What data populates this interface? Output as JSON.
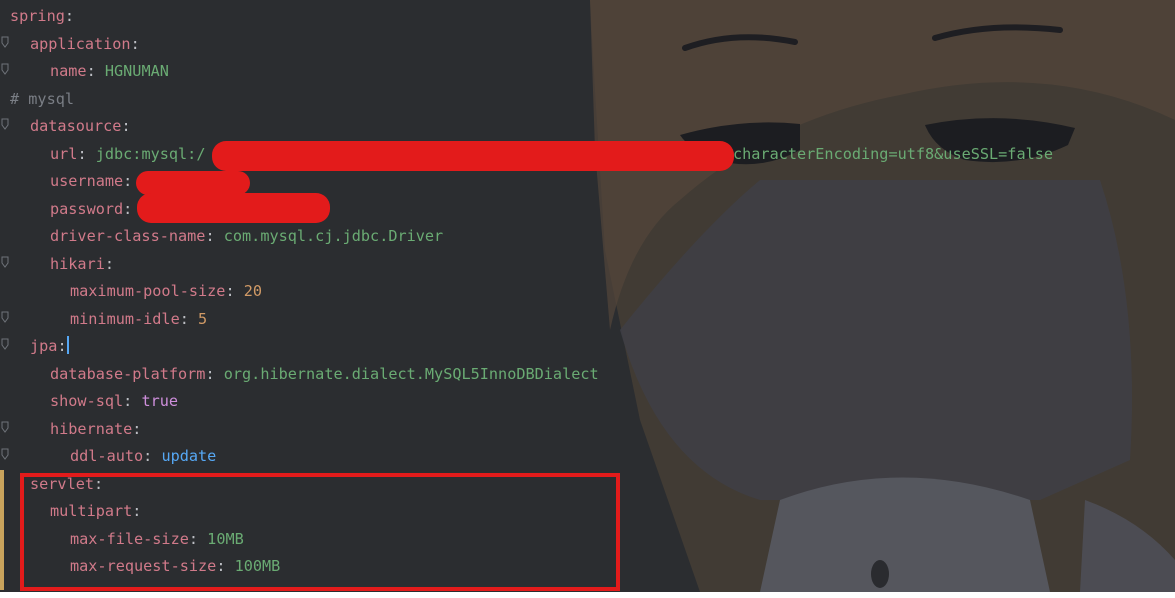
{
  "editor": {
    "language": "yaml",
    "colors": {
      "background": "#2b2d30",
      "key": "#d17a8a",
      "comment": "#7a7e85",
      "string": "#6aab73",
      "number": "#d19a66",
      "boolean": "#cf8fdc",
      "enum": "#56a8f5",
      "redaction": "#e31b1b"
    },
    "lines": [
      {
        "key": "spring",
        "sep": ":"
      },
      {
        "key": "application",
        "sep": ":"
      },
      {
        "key": "name",
        "sep": ": ",
        "value": "HGNUMAN"
      },
      {
        "comment": "# mysql"
      },
      {
        "key": "datasource",
        "sep": ":"
      },
      {
        "key": "url",
        "sep": ": ",
        "value_prefix": "jdbc:mysql:/",
        "value_suffix": "characterEncoding=utf8&useSSL=false"
      },
      {
        "key": "username",
        "sep": ":"
      },
      {
        "key": "password",
        "sep": ":"
      },
      {
        "key": "driver-class-name",
        "sep": ": ",
        "value": "com.mysql.cj.jdbc.Driver"
      },
      {
        "key": "hikari",
        "sep": ":"
      },
      {
        "key": "maximum-pool-size",
        "sep": ": ",
        "value": "20"
      },
      {
        "key": "minimum-idle",
        "sep": ": ",
        "value": "5"
      },
      {
        "key": "jpa",
        "sep": ":"
      },
      {
        "key": "database-platform",
        "sep": ": ",
        "value": "org.hibernate.dialect.MySQL5InnoDBDialect"
      },
      {
        "key": "show-sql",
        "sep": ": ",
        "value": "true"
      },
      {
        "key": "hibernate",
        "sep": ":"
      },
      {
        "key": "ddl-auto",
        "sep": ": ",
        "value": "update"
      },
      {
        "key": "servlet",
        "sep": ":"
      },
      {
        "key": "multipart",
        "sep": ":"
      },
      {
        "key": "max-file-size",
        "sep": ": ",
        "value": "10MB"
      },
      {
        "key": "max-request-size",
        "sep": ": ",
        "value": "100MB"
      }
    ]
  }
}
